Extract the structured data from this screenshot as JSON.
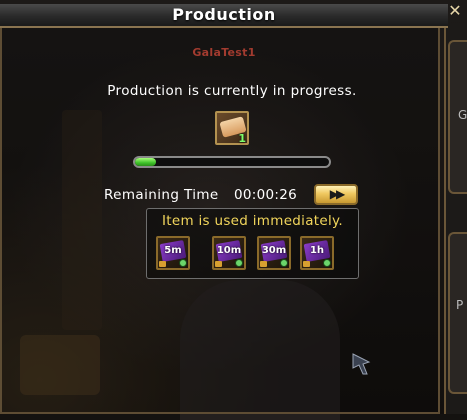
{
  "window": {
    "title": "Production",
    "close_label": "✕",
    "username": "GalaTest1"
  },
  "side_panel": {
    "tab1_label": "G",
    "tab2_label": "P"
  },
  "production": {
    "status_text": "Production is currently in progress.",
    "item_icon": "scroll-icon",
    "item_count": "1",
    "progress": 0.11,
    "remaining_label": "Remaining Time",
    "remaining_value": "00:00:26",
    "fast_forward_label": "▶▶"
  },
  "boosts": {
    "title": "Item is used immediately.",
    "items": [
      {
        "label": "5m",
        "icon": "time-ticket-icon"
      },
      {
        "label": "10m",
        "icon": "time-ticket-icon"
      },
      {
        "label": "30m",
        "icon": "time-ticket-icon"
      },
      {
        "label": "1h",
        "icon": "time-ticket-icon"
      }
    ]
  },
  "colors": {
    "title_text": "#ffffff",
    "username": "#a23b2f",
    "boost_title": "#f2d65c",
    "progress_fill": "#3ec22a",
    "frame": "#5e4d34"
  }
}
